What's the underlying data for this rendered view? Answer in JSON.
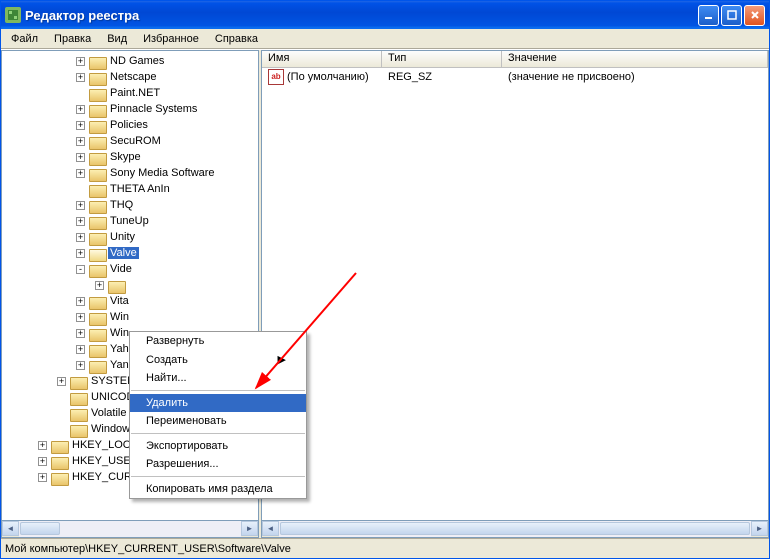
{
  "title": "Редактор реестра",
  "menu": {
    "file": "Файл",
    "edit": "Правка",
    "view": "Вид",
    "fav": "Избранное",
    "help": "Справка"
  },
  "tree": {
    "items": [
      {
        "indent": 74,
        "pm": "+",
        "label": "ND Games"
      },
      {
        "indent": 74,
        "pm": "+",
        "label": "Netscape"
      },
      {
        "indent": 74,
        "pm": "",
        "label": "Paint.NET"
      },
      {
        "indent": 74,
        "pm": "+",
        "label": "Pinnacle Systems"
      },
      {
        "indent": 74,
        "pm": "+",
        "label": "Policies"
      },
      {
        "indent": 74,
        "pm": "+",
        "label": "SecuROM"
      },
      {
        "indent": 74,
        "pm": "+",
        "label": "Skype"
      },
      {
        "indent": 74,
        "pm": "+",
        "label": "Sony Media Software"
      },
      {
        "indent": 74,
        "pm": "",
        "label": "THETA AnIn"
      },
      {
        "indent": 74,
        "pm": "+",
        "label": "THQ"
      },
      {
        "indent": 74,
        "pm": "+",
        "label": "TuneUp"
      },
      {
        "indent": 74,
        "pm": "+",
        "label": "Unity"
      },
      {
        "indent": 74,
        "pm": "+",
        "label": "Valve",
        "selected": true,
        "open": true
      },
      {
        "indent": 74,
        "pm": "-",
        "label": "Vide"
      },
      {
        "indent": 93,
        "pm": "+",
        "label": ""
      },
      {
        "indent": 74,
        "pm": "+",
        "label": "Vita"
      },
      {
        "indent": 74,
        "pm": "+",
        "label": "Win"
      },
      {
        "indent": 74,
        "pm": "+",
        "label": "Win"
      },
      {
        "indent": 74,
        "pm": "+",
        "label": "Yah"
      },
      {
        "indent": 74,
        "pm": "+",
        "label": "Yan"
      },
      {
        "indent": 55,
        "pm": "+",
        "label": "SYSTEM"
      },
      {
        "indent": 55,
        "pm": "",
        "label": "UNICOD"
      },
      {
        "indent": 55,
        "pm": "",
        "label": "Volatile Environment"
      },
      {
        "indent": 55,
        "pm": "",
        "label": "Windows 3.1 Migration Status"
      },
      {
        "indent": 36,
        "pm": "+",
        "label": "HKEY_LOCAL_MACHINE"
      },
      {
        "indent": 36,
        "pm": "+",
        "label": "HKEY_USERS"
      },
      {
        "indent": 36,
        "pm": "+",
        "label": "HKEY_CURRENT_CONFIG"
      }
    ]
  },
  "list": {
    "headers": {
      "name": "Имя",
      "type": "Тип",
      "value": "Значение"
    },
    "row": {
      "name": "(По умолчанию)",
      "type": "REG_SZ",
      "value": "(значение не присвоено)"
    }
  },
  "context": {
    "expand": "Развернуть",
    "create": "Создать",
    "find": "Найти...",
    "delete": "Удалить",
    "rename": "Переименовать",
    "export": "Экспортировать",
    "perms": "Разрешения...",
    "copy": "Копировать имя раздела"
  },
  "status": "Мой компьютер\\HKEY_CURRENT_USER\\Software\\Valve"
}
